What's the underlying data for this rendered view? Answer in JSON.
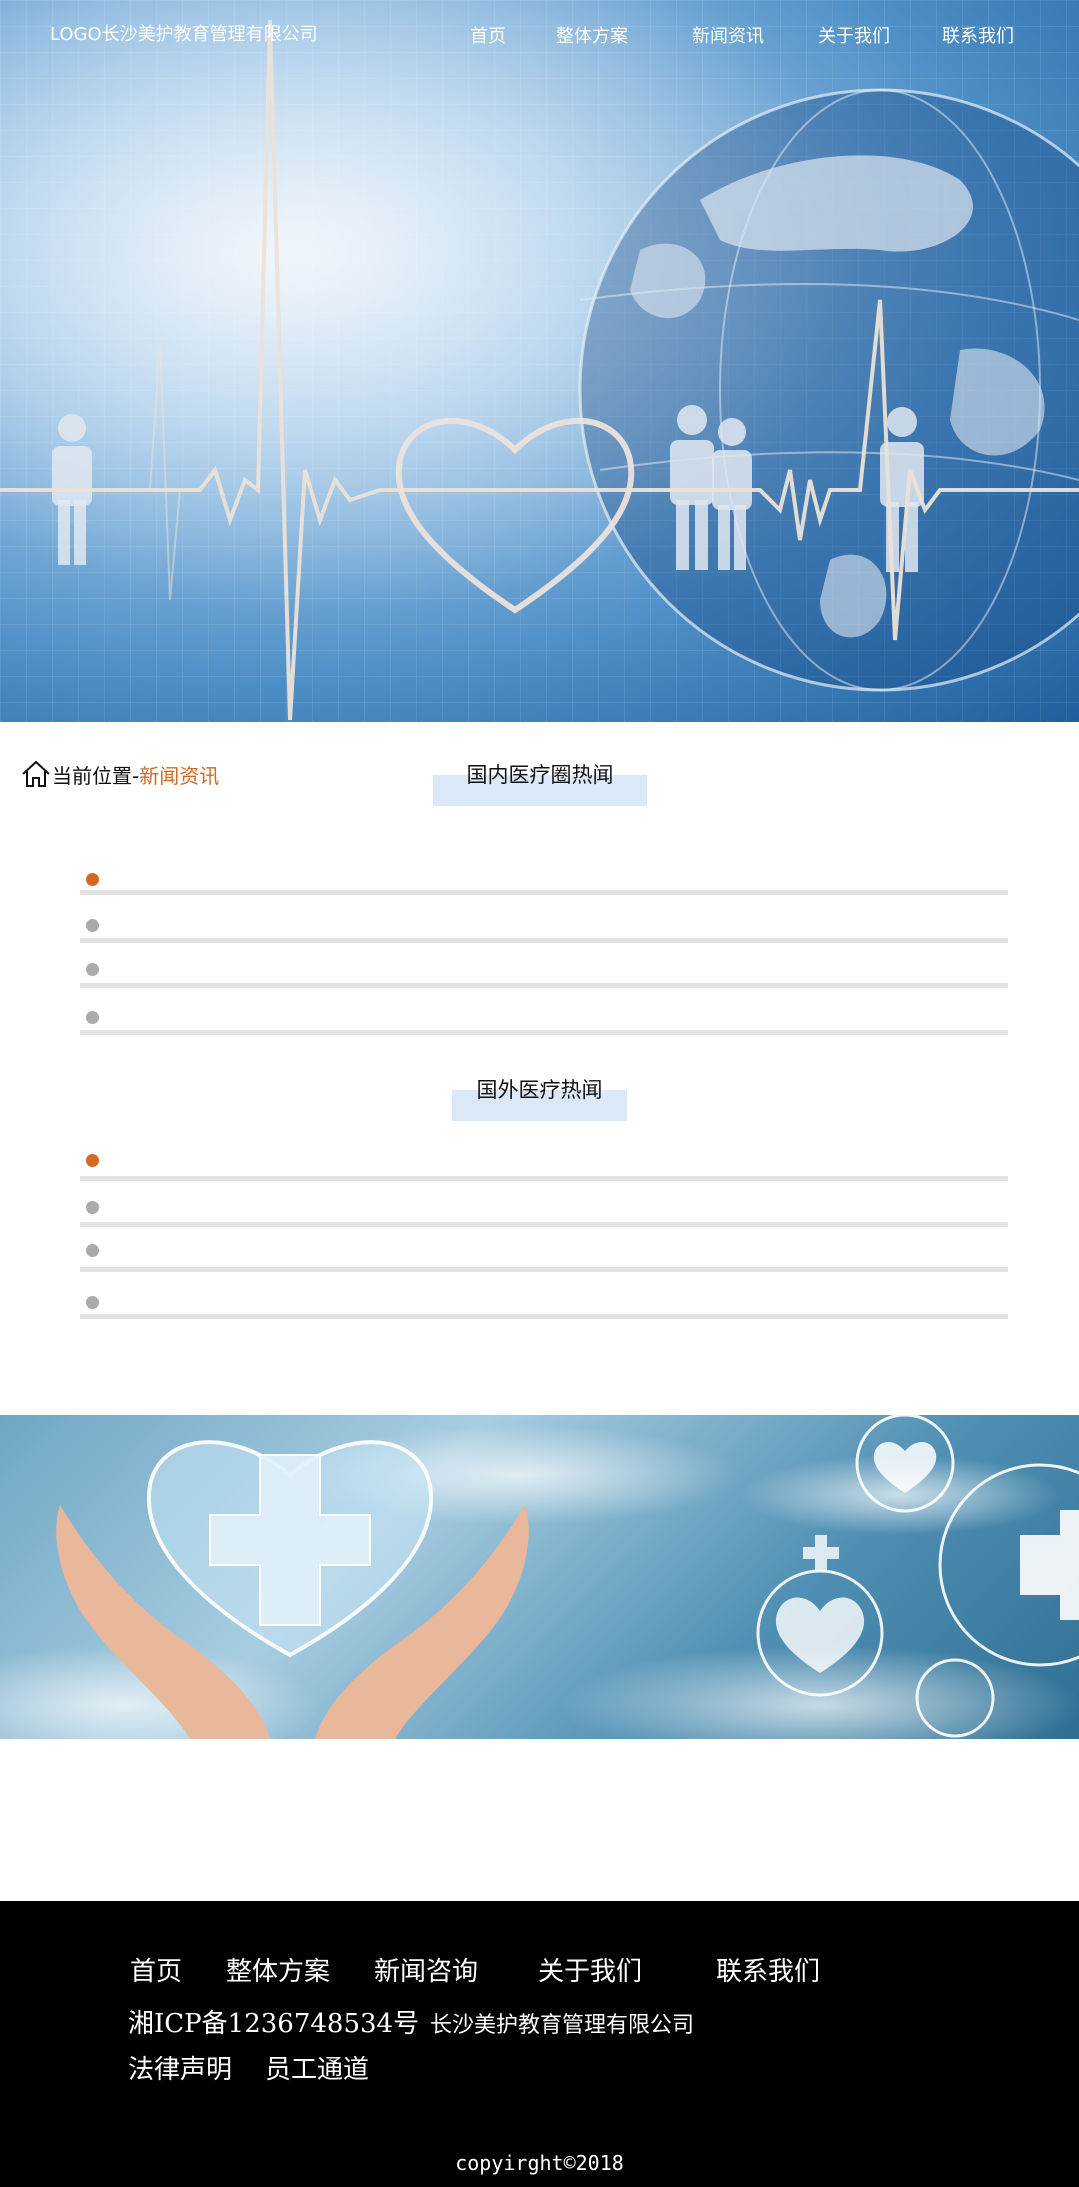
{
  "header": {
    "logo": "LOGO长沙美护教育管理有限公司",
    "nav": [
      "首页",
      "整体方案",
      "新闻资讯",
      "关于我们",
      "联系我们"
    ]
  },
  "breadcrumb": {
    "prefix": "当前位置-",
    "current": "新闻资讯"
  },
  "sections": [
    {
      "title": "国内医疗圈热闻",
      "items": [
        "",
        "",
        "",
        ""
      ]
    },
    {
      "title": "国外医疗热闻",
      "items": [
        "",
        "",
        "",
        ""
      ]
    }
  ],
  "footer": {
    "nav": [
      "首页",
      "整体方案",
      "新闻咨询",
      "关于我们",
      "联系我们"
    ],
    "icp": "湘ICP备1236748534号",
    "company": "长沙美护教育管理有限公司",
    "legal": "法律声明",
    "staff": "员工通道",
    "copyright": "copyirght©2018"
  },
  "colors": {
    "accent": "#d2691e",
    "title_bg": "#dbe8f8",
    "footer_bg": "#000000"
  },
  "icons": {
    "home": "home-icon"
  }
}
